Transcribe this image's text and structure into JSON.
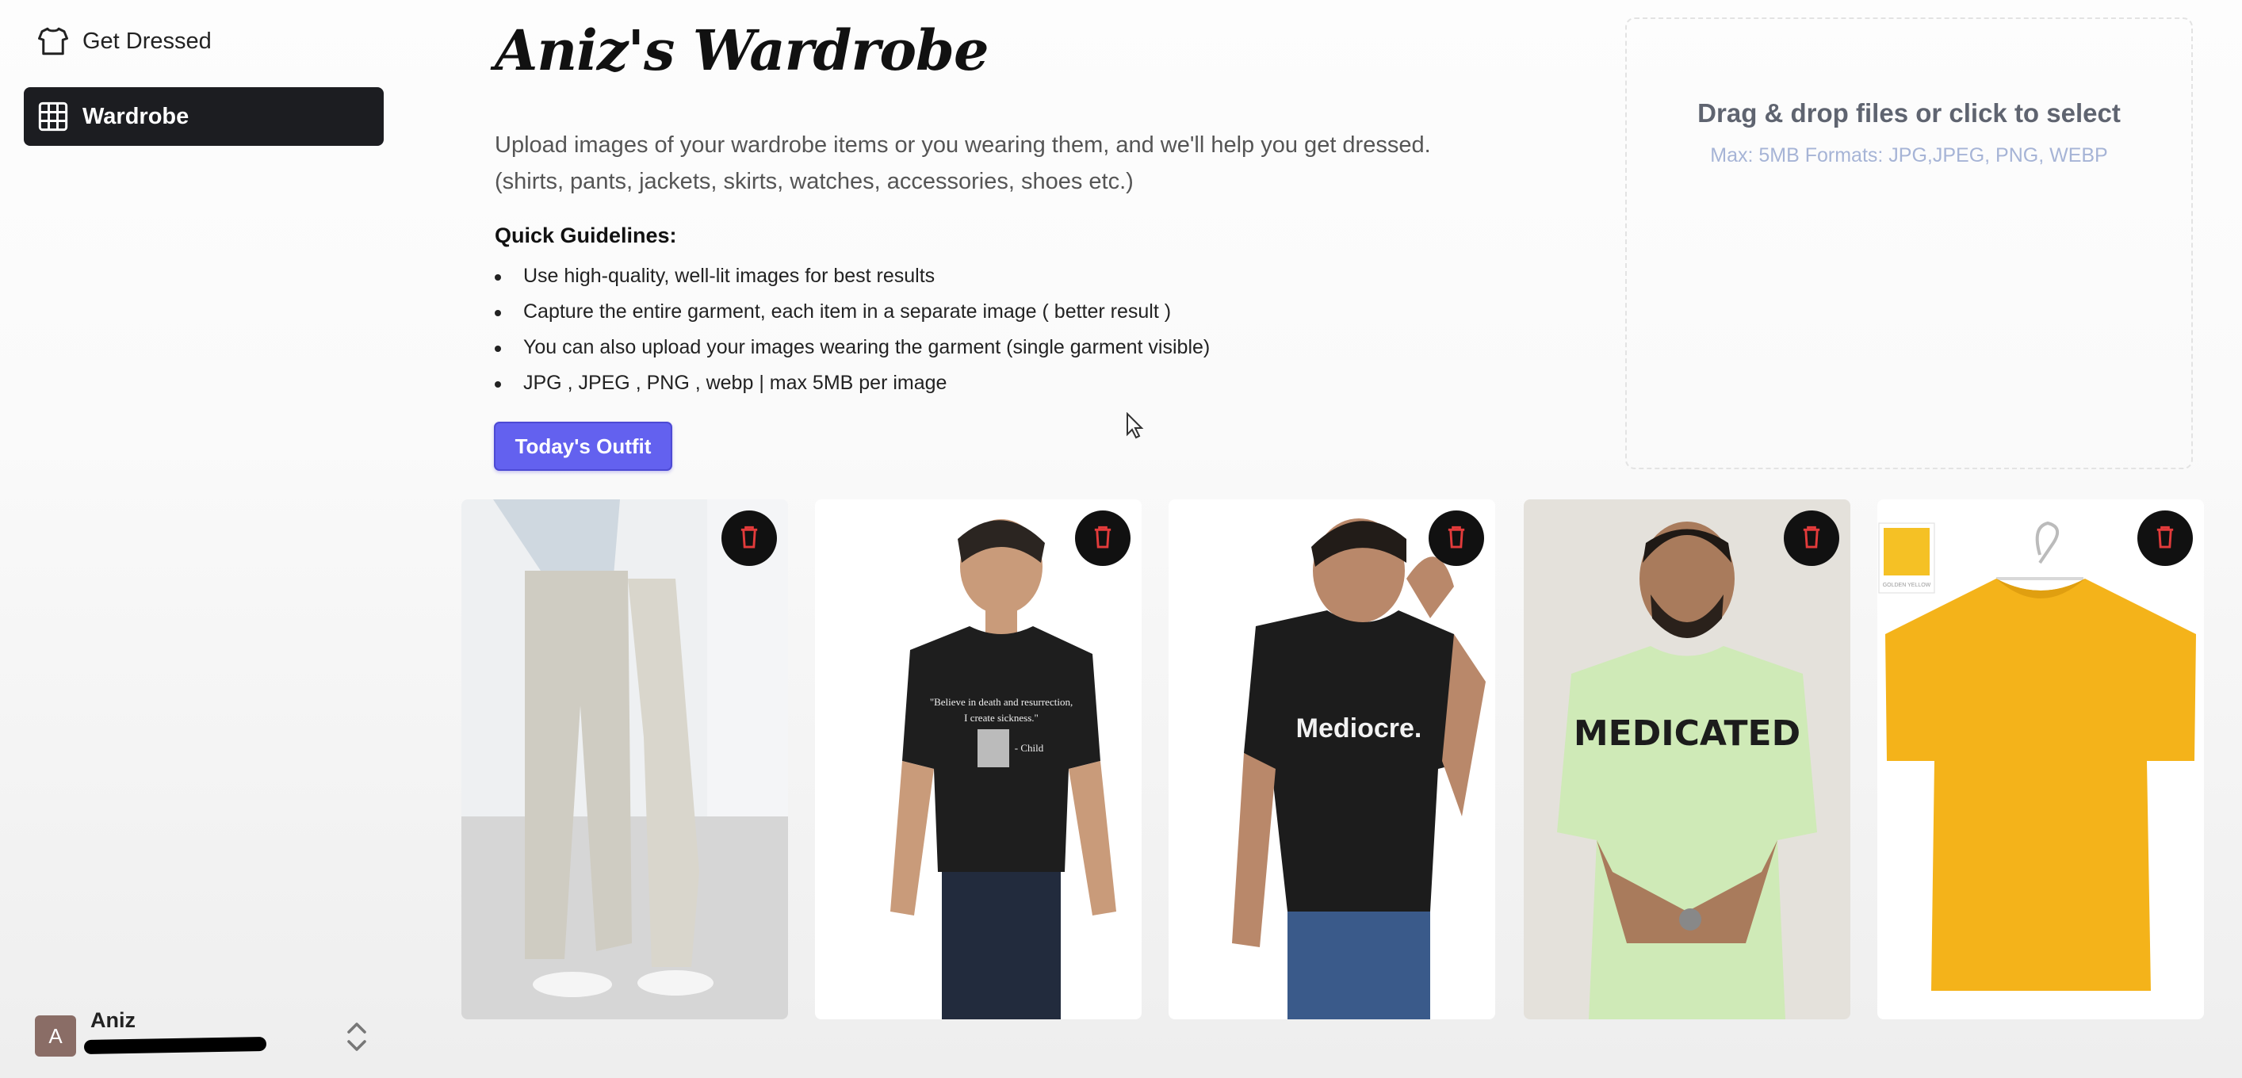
{
  "sidebar": {
    "items": [
      {
        "label": "Get Dressed",
        "icon": "tshirt-icon"
      },
      {
        "label": "Wardrobe",
        "icon": "grid-icon",
        "active": true
      }
    ],
    "user": {
      "initial": "A",
      "name": "Aniz"
    }
  },
  "main": {
    "title": "Aniz's Wardrobe",
    "intro_line1": "Upload images of your wardrobe items or you wearing them, and we'll help you get dressed.",
    "intro_line2": "(shirts, pants, jackets, skirts, watches, accessories, shoes etc.)",
    "guidelines_title": "Quick Guidelines:",
    "guidelines": [
      "Use high-quality, well-lit images for best results",
      "Capture the entire garment, each item in a separate image ( better result )",
      "You can also upload your images wearing the garment (single garment visible)",
      "JPG , JPEG , PNG , webp | max 5MB per image"
    ],
    "outfit_button": "Today's Outfit"
  },
  "dropzone": {
    "title": "Drag & drop files or click to select",
    "subtitle": "Max: 5MB Formats: JPG,JPEG, PNG, WEBP"
  },
  "gallery": {
    "items": [
      {
        "name": "beige-pants-photo"
      },
      {
        "name": "black-graphic-tee-photo",
        "print_line1": "\"Believe in death and resurrection,",
        "print_line2": "I create sickness.\"",
        "print_line3": "- Child"
      },
      {
        "name": "black-mediocre-tee-photo",
        "print_text": "Mediocre."
      },
      {
        "name": "green-medicated-tee-photo",
        "print_text": "MEDICATED"
      },
      {
        "name": "yellow-tee-photo",
        "swatch_text": "GOLDEN YELLOW"
      }
    ],
    "delete_icon": "trash-icon"
  },
  "colors": {
    "accent": "#6361ef",
    "sidebar_active": "#1c1d21",
    "delete_icon": "#e23b3b"
  }
}
